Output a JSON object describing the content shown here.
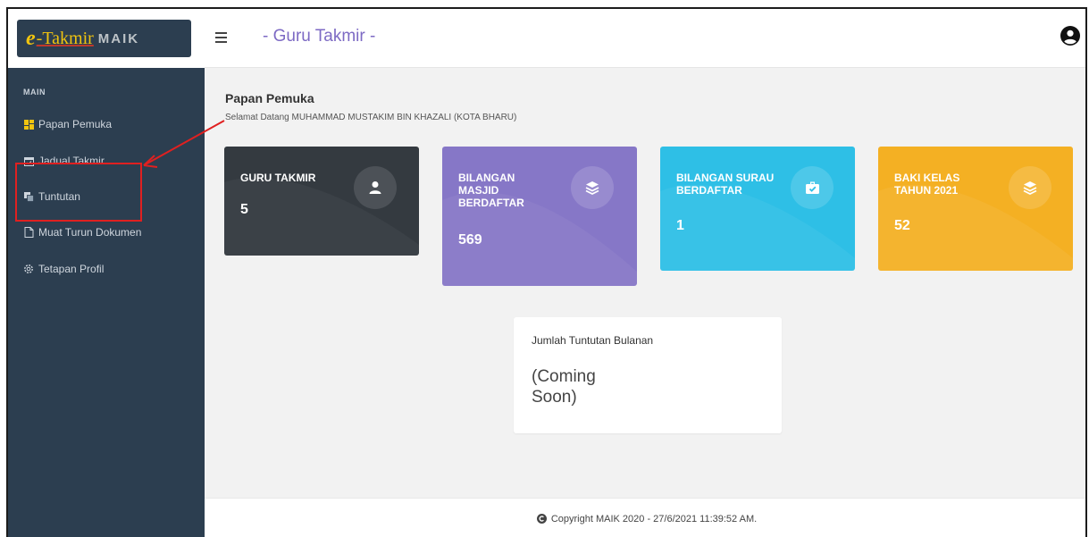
{
  "logo": {
    "e": "e",
    "takmir": "-Takmir",
    "maik": "MAIK"
  },
  "topbar": {
    "title": "- Guru Takmir -"
  },
  "sidebar": {
    "heading": "MAIN",
    "items": [
      {
        "label": "Papan Pemuka",
        "icon": "dashboard-icon"
      },
      {
        "label": "Jadual Takmir",
        "icon": "calendar-icon"
      },
      {
        "label": "Tuntutan",
        "icon": "copy-icon"
      },
      {
        "label": "Muat Turun Dokumen",
        "icon": "document-icon"
      },
      {
        "label": "Tetapan Profil",
        "icon": "gear-icon"
      }
    ]
  },
  "page": {
    "title": "Papan Pemuka",
    "subtitle": "Selamat Datang MUHAMMAD MUSTAKIM BIN KHAZALI (KOTA BHARU)"
  },
  "cards": [
    {
      "label": "GURU TAKMIR",
      "value": "5",
      "color": "#343a40",
      "icon": "user-icon"
    },
    {
      "label": "BILANGAN MASJID BERDAFTAR",
      "value": "569",
      "color": "#8677c7",
      "icon": "layers-icon"
    },
    {
      "label": "BILANGAN SURAU BERDAFTAR",
      "value": "1",
      "color": "#2ebfe6",
      "icon": "briefcase-check-icon"
    },
    {
      "label": "BAKI KELAS TAHUN 2021",
      "value": "52",
      "color": "#f4b023",
      "icon": "layers-icon"
    }
  ],
  "monthly": {
    "title": "Jumlah Tuntutan Bulanan",
    "value": "(Coming Soon)"
  },
  "footer": {
    "text": "Copyright MAIK 2020 - 27/6/2021 11:39:52 AM."
  },
  "colors": {
    "sidebar": "#2c3e50",
    "accent": "#7d6ac4",
    "annotation": "#e02020"
  }
}
